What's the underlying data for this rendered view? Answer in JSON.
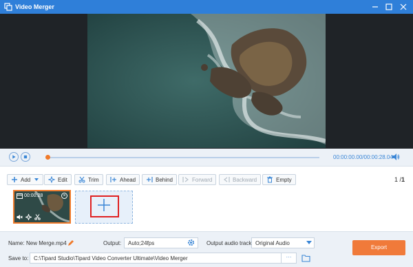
{
  "window": {
    "title": "Video Merger"
  },
  "player": {
    "current_time": "00:00:00.00",
    "separator": "/",
    "duration": "00:00:28.04",
    "progress": 0.0
  },
  "toolbar": {
    "add": "Add",
    "edit": "Edit",
    "trim": "Trim",
    "ahead": "Ahead",
    "behind": "Behind",
    "forward": "Forward",
    "backward": "Backward",
    "empty": "Empty",
    "page_current": "1",
    "page_sep": "/",
    "page_total": "1"
  },
  "clips": [
    {
      "duration": "00:00:28"
    }
  ],
  "footer": {
    "name_label": "Name:",
    "name_value": "New Merge.mp4",
    "output_label": "Output:",
    "output_value": "Auto;24fps",
    "audio_label": "Output audio track:",
    "audio_value": "Original Audio",
    "save_label": "Save to:",
    "save_path": "C:\\Tipard Studio\\Tipard Video Converter Ultimate\\Video Merger",
    "browse_label": "···",
    "export_label": "Export"
  },
  "colors": {
    "titlebar": "#2f7fd9",
    "accent": "#f07a2a",
    "highlight": "#e02020"
  },
  "icons": [
    "app-icon",
    "minimize-icon",
    "maximize-icon",
    "close-icon",
    "play-icon",
    "stop-icon",
    "volume-icon",
    "plus-icon",
    "edit-icon",
    "trim-icon",
    "ahead-icon",
    "behind-icon",
    "forward-icon",
    "backward-icon",
    "trash-icon",
    "pencil-icon",
    "gear-icon",
    "folder-icon"
  ]
}
